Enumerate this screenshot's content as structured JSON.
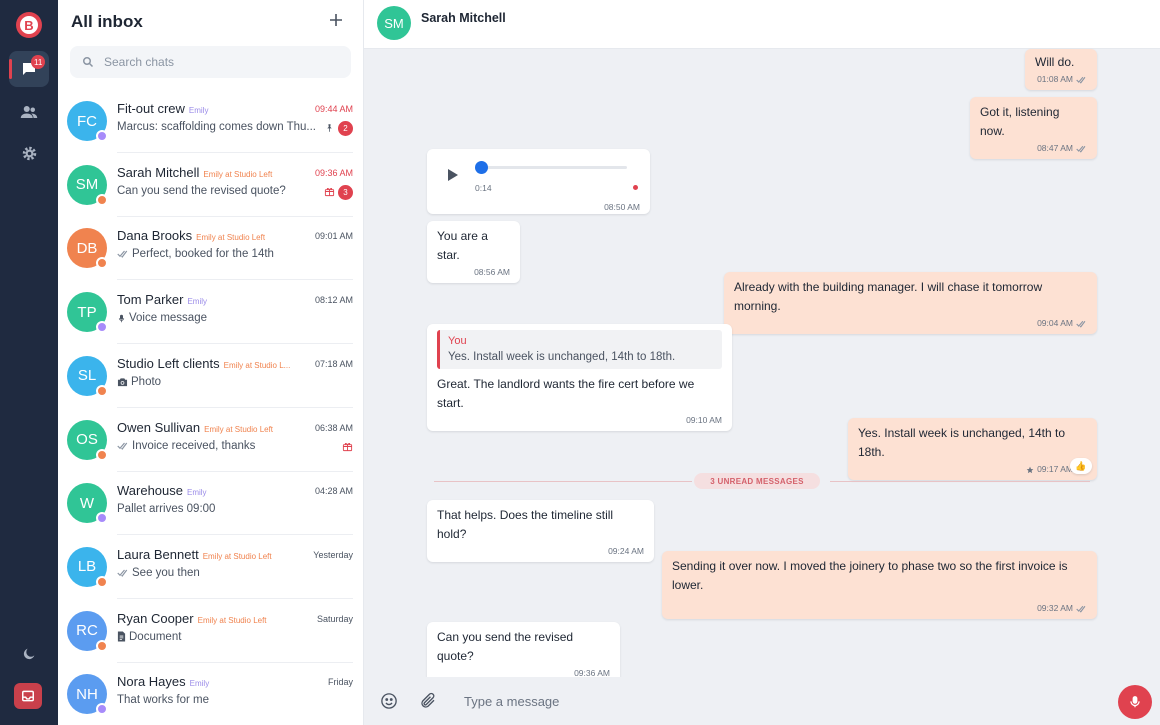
{
  "app": {
    "logo_letter": "B",
    "unread_badge": "11"
  },
  "colors": {
    "accent": "#e0424f",
    "sidebar_bg": "#1f2a40",
    "outgoing_bubble": "#fde1d3",
    "incoming_bubble": "#ffffff",
    "conversation_bg": "#eef0f4",
    "tag_purple": "#9a8be8",
    "tag_orange": "#f0834f"
  },
  "inbox": {
    "title": "All inbox",
    "search_placeholder": "Search chats",
    "chats": [
      {
        "initials": "FC",
        "avatar_color": "#3bb4ec",
        "status_color": "#a78bfa",
        "name": "Fit-out crew",
        "tag": "Emily",
        "tag_color": "#9a8be8",
        "time": "09:44 AM",
        "time_highlight": true,
        "preview": "Marcus: scaffolding comes down Thu...",
        "preview_icon": "",
        "side_icon": "pin-icon",
        "unread": "2"
      },
      {
        "initials": "SM",
        "avatar_color": "#30c596",
        "status_color": "#f0834f",
        "name": "Sarah Mitchell",
        "tag": "Emily at Studio Left",
        "tag_color": "#f0834f",
        "time": "09:36 AM",
        "time_highlight": true,
        "preview": "Can you send the revised quote?",
        "preview_icon": "",
        "side_icon": "gift-icon",
        "unread": "3"
      },
      {
        "initials": "DB",
        "avatar_color": "#f0834f",
        "status_color": "#f0834f",
        "name": "Dana Brooks",
        "tag": "Emily at Studio Left",
        "tag_color": "#f0834f",
        "time": "09:01 AM",
        "time_highlight": false,
        "preview": "Perfect, booked for the 14th",
        "preview_icon": "double-check-icon",
        "side_icon": "",
        "unread": ""
      },
      {
        "initials": "TP",
        "avatar_color": "#30c596",
        "status_color": "#a78bfa",
        "name": "Tom Parker",
        "tag": "Emily",
        "tag_color": "#9a8be8",
        "time": "08:12 AM",
        "time_highlight": false,
        "preview": "Voice message",
        "preview_icon": "mic-icon",
        "side_icon": "",
        "unread": ""
      },
      {
        "initials": "SL",
        "avatar_color": "#3bb4ec",
        "status_color": "#f0834f",
        "name": "Studio Left clients",
        "tag": "Emily at Studio L...",
        "tag_color": "#f0834f",
        "time": "07:18 AM",
        "time_highlight": false,
        "preview": "Photo",
        "preview_icon": "camera-icon",
        "side_icon": "",
        "unread": ""
      },
      {
        "initials": "OS",
        "avatar_color": "#30c596",
        "status_color": "#f0834f",
        "name": "Owen Sullivan",
        "tag": "Emily at Studio Left",
        "tag_color": "#f0834f",
        "time": "06:38 AM",
        "time_highlight": false,
        "preview": "Invoice received, thanks",
        "preview_icon": "double-check-icon",
        "side_icon": "gift-icon",
        "unread": ""
      },
      {
        "initials": "W",
        "avatar_color": "#30c596",
        "status_color": "#a78bfa",
        "name": "Warehouse",
        "tag": "Emily",
        "tag_color": "#9a8be8",
        "time": "04:28 AM",
        "time_highlight": false,
        "preview": "Pallet arrives 09:00",
        "preview_icon": "",
        "side_icon": "",
        "unread": ""
      },
      {
        "initials": "LB",
        "avatar_color": "#3bb4ec",
        "status_color": "#f0834f",
        "name": "Laura Bennett",
        "tag": "Emily at Studio Left",
        "tag_color": "#f0834f",
        "time": "Yesterday",
        "time_highlight": false,
        "preview": "See you then",
        "preview_icon": "double-check-icon",
        "side_icon": "",
        "unread": ""
      },
      {
        "initials": "RC",
        "avatar_color": "#5b9cf0",
        "status_color": "#f0834f",
        "name": "Ryan Cooper",
        "tag": "Emily at Studio Left",
        "tag_color": "#f0834f",
        "time": "Saturday",
        "time_highlight": false,
        "preview": "Document",
        "preview_icon": "document-icon",
        "side_icon": "",
        "unread": ""
      },
      {
        "initials": "NH",
        "avatar_color": "#5b9cf0",
        "status_color": "#a78bfa",
        "name": "Nora Hayes",
        "tag": "Emily",
        "tag_color": "#9a8be8",
        "time": "Friday",
        "time_highlight": false,
        "preview": "That works for me",
        "preview_icon": "",
        "side_icon": "",
        "unread": ""
      }
    ]
  },
  "conversation": {
    "contact_initials": "SM",
    "contact_name": "Sarah Mitchell",
    "messages": [
      {
        "dir": "out",
        "text": "Will do.",
        "time": "01:08 AM"
      },
      {
        "dir": "out",
        "text": "Got it, listening now.",
        "time": "08:47 AM"
      },
      {
        "dir": "in",
        "type": "voice",
        "duration": "0:14",
        "time": "08:50 AM",
        "progress": 0
      },
      {
        "dir": "in",
        "text": "You are a star.",
        "time": "08:56 AM"
      },
      {
        "dir": "out",
        "text": "Already with the building manager. I will chase it tomorrow morning.",
        "time": "09:04 AM"
      },
      {
        "dir": "in",
        "text": "Great. The landlord wants the fire cert before we start.",
        "time": "09:10 AM",
        "reply_author": "You",
        "reply_text": "Yes. Install week is unchanged, 14th to 18th."
      },
      {
        "dir": "out",
        "text": "Yes. Install week is unchanged, 14th to 18th.",
        "time": "09:17 AM",
        "starred": true,
        "reaction": "👍"
      },
      {
        "dir": "in",
        "text": "That helps. Does the timeline still hold?",
        "time": "09:24 AM"
      },
      {
        "dir": "out",
        "text": "Sending it over now. I moved the joinery to phase two so the first invoice is lower.",
        "time": "09:32 AM"
      },
      {
        "dir": "in",
        "text": "Can you send the revised quote?",
        "time": "09:36 AM"
      }
    ],
    "unread_divider": "3 UNREAD MESSAGES"
  },
  "composer": {
    "placeholder": "Type a message"
  }
}
